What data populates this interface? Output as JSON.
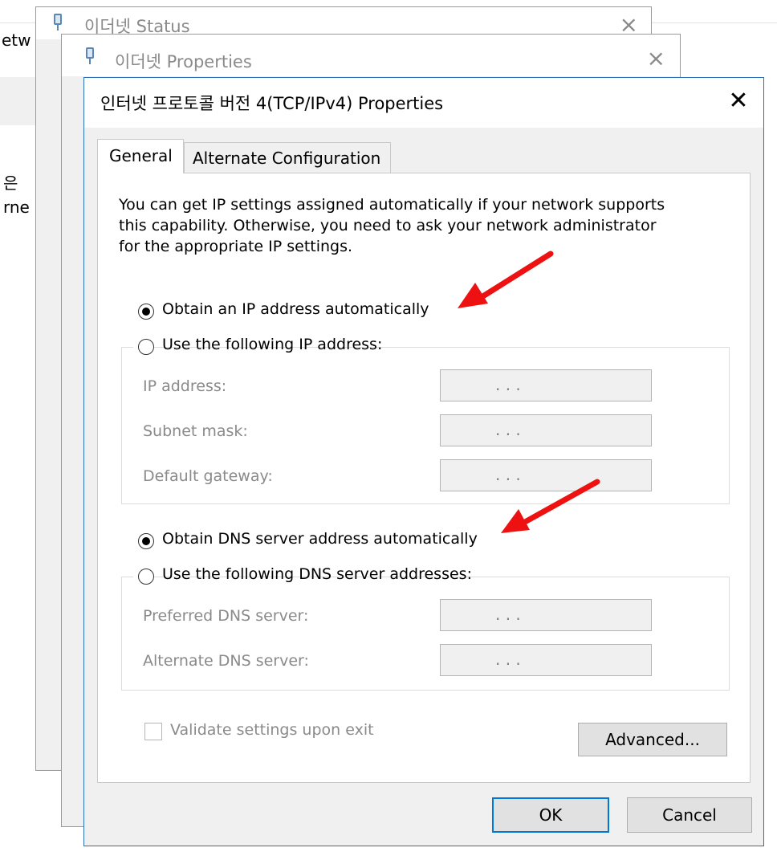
{
  "background": {
    "network_fragment_1": "etw",
    "network_fragment_2": "은",
    "network_fragment_3": "rne"
  },
  "status_window": {
    "title": "이더넷 Status"
  },
  "properties_window": {
    "title": "이더넷 Properties"
  },
  "dialog": {
    "title": "인터넷 프로토콜 버전 4(TCP/IPv4) Properties",
    "tabs": [
      {
        "label": "General",
        "active": true
      },
      {
        "label": "Alternate Configuration",
        "active": false
      }
    ],
    "description": [
      "You can get IP settings assigned automatically if your network supports",
      "this capability. Otherwise, you need to ask your network administrator",
      "for the appropriate IP settings."
    ],
    "ip": {
      "auto_label": "Obtain an IP address automatically",
      "auto_selected": true,
      "manual_label": "Use the following IP address:",
      "fields": [
        {
          "label": "IP address:",
          "value": ".      .      ."
        },
        {
          "label": "Subnet mask:",
          "value": ".      .      ."
        },
        {
          "label": "Default gateway:",
          "value": ".      .      ."
        }
      ]
    },
    "dns": {
      "auto_label": "Obtain DNS server address automatically",
      "auto_selected": true,
      "manual_label": "Use the following DNS server addresses:",
      "fields": [
        {
          "label": "Preferred DNS server:",
          "value": ".      .      ."
        },
        {
          "label": "Alternate DNS server:",
          "value": ".      .      ."
        }
      ]
    },
    "validate_label": "Validate settings upon exit",
    "validate_checked": false,
    "advanced_button": "Advanced...",
    "ok_button": "OK",
    "cancel_button": "Cancel"
  },
  "colors": {
    "accent": "#0078d7",
    "annotation_arrow": "#ee1111",
    "disabled_text": "#8a8a8a"
  }
}
